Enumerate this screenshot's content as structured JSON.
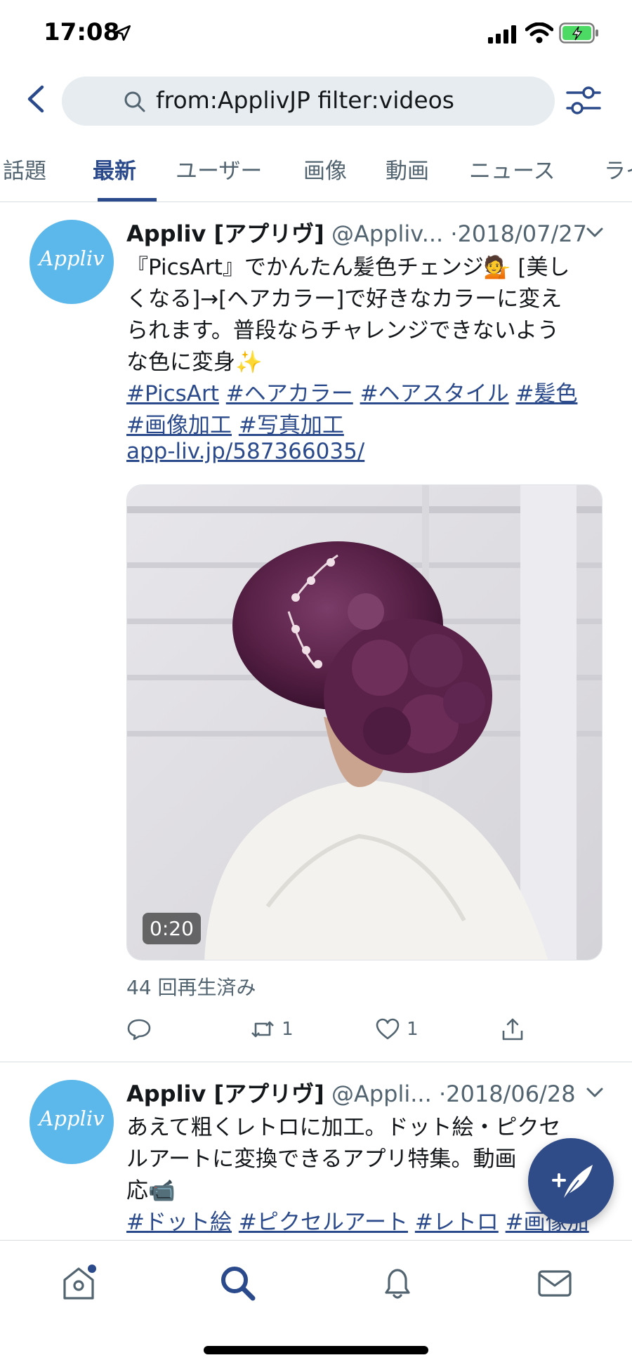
{
  "status_bar": {
    "time": "17:08"
  },
  "search": {
    "query": "from:ApplivJP filter:videos"
  },
  "tabs": [
    {
      "label": "話題"
    },
    {
      "label": "最新"
    },
    {
      "label": "ユーザー"
    },
    {
      "label": "画像"
    },
    {
      "label": "動画"
    },
    {
      "label": "ニュース"
    },
    {
      "label": "ライ"
    }
  ],
  "tweets": [
    {
      "avatar_text": "Appliv",
      "name": "Appliv [アプリヴ]",
      "handle": "@Appliv...",
      "date": "·2018/07/27",
      "lines": [
        "『PicsArt』でかんたん髪色チェンジ💁 [美し",
        "くなる]→[ヘアカラー]で好きなカラーに変え",
        "られます。普段ならチャレンジできないよう",
        "な色に変身✨"
      ],
      "hashtags_row1": [
        "#PicsArt",
        "#ヘアカラー",
        "#ヘアスタイル",
        "#髪色"
      ],
      "hashtags_row2": [
        "#画像加工",
        "#写真加工"
      ],
      "link": "app-liv.jp/587366035/",
      "video_duration": "0:20",
      "views": "44 回再生済み",
      "retweets": "1",
      "likes": "1"
    },
    {
      "avatar_text": "Appliv",
      "name": "Appliv [アプリヴ]",
      "handle": "@Appli...",
      "date": "·2018/06/28",
      "lines": [
        "あえて粗くレトロに加工。ドット絵・ピクセ",
        "ルアートに変換できるアプリ特集。動画",
        "応📹"
      ],
      "hashtags_row1": [
        "#ドット絵",
        "#ピクセルアート",
        "#レトロ",
        "#画像加"
      ]
    }
  ],
  "colors": {
    "accent": "#2b4a8b",
    "avatar_bg": "#5cb8ea",
    "fab_bg": "#2f4b88"
  }
}
